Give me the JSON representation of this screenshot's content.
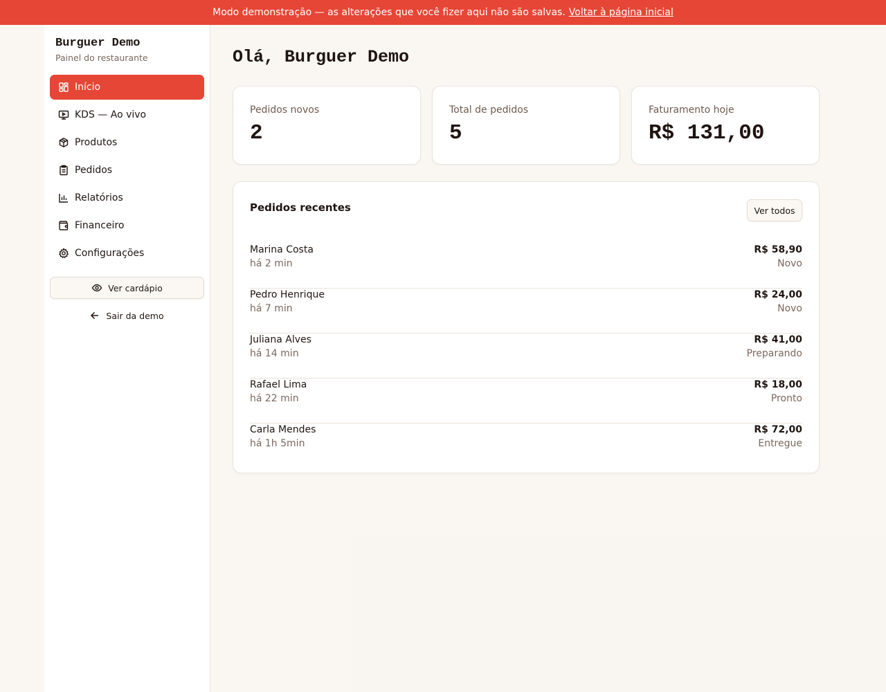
{
  "banner": {
    "message": "Modo demonstração — as alterações que você fizer aqui não são salvas.",
    "link": "Voltar à página inicial"
  },
  "sidebar": {
    "title": "Burguer Demo",
    "subtitle": "Painel do restaurante",
    "items": [
      {
        "label": "Início",
        "icon": "dashboard-icon"
      },
      {
        "label": "KDS — Ao vivo",
        "icon": "monitor-play-icon"
      },
      {
        "label": "Produtos",
        "icon": "package-icon"
      },
      {
        "label": "Pedidos",
        "icon": "clipboard-icon"
      },
      {
        "label": "Relatórios",
        "icon": "bar-chart-icon"
      },
      {
        "label": "Financeiro",
        "icon": "wallet-icon"
      },
      {
        "label": "Configurações",
        "icon": "gear-icon"
      }
    ],
    "menu_button": "Ver cardápio",
    "exit_button": "Sair da demo"
  },
  "main": {
    "greeting": "Olá, Burguer Demo",
    "stats": [
      {
        "label": "Pedidos novos",
        "value": "2"
      },
      {
        "label": "Total de pedidos",
        "value": "5"
      },
      {
        "label": "Faturamento hoje",
        "value": "R$ 131,00"
      }
    ],
    "recent": {
      "title": "Pedidos recentes",
      "view_all": "Ver todos",
      "orders": [
        {
          "name": "Marina Costa",
          "time": "há 2 min",
          "price": "R$ 58,90",
          "status": "Novo"
        },
        {
          "name": "Pedro Henrique",
          "time": "há 7 min",
          "price": "R$ 24,00",
          "status": "Novo"
        },
        {
          "name": "Juliana Alves",
          "time": "há 14 min",
          "price": "R$ 41,00",
          "status": "Preparando"
        },
        {
          "name": "Rafael Lima",
          "time": "há 22 min",
          "price": "R$ 18,00",
          "status": "Pronto"
        },
        {
          "name": "Carla Mendes",
          "time": "há 1h 5min",
          "price": "R$ 72,00",
          "status": "Entregue"
        }
      ]
    }
  },
  "colors": {
    "accent": "#e64636",
    "background": "#faf7f3",
    "muted_text": "#7a675c"
  }
}
